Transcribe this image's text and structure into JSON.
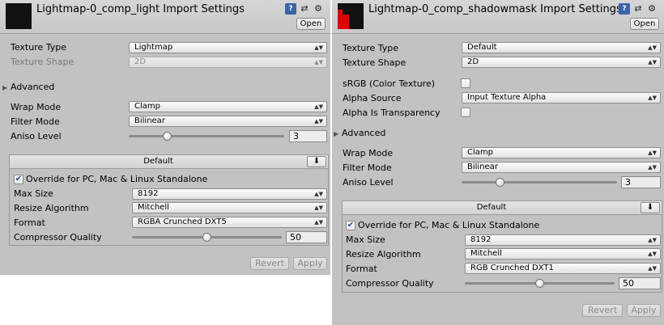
{
  "left": {
    "title": "Lightmap-0_comp_light Import Settings",
    "open_label": "Open",
    "texture_type": {
      "label": "Texture Type",
      "value": "Lightmap"
    },
    "texture_shape": {
      "label": "Texture Shape",
      "value": "2D"
    },
    "advanced_label": "Advanced",
    "wrap_mode": {
      "label": "Wrap Mode",
      "value": "Clamp"
    },
    "filter_mode": {
      "label": "Filter Mode",
      "value": "Bilinear"
    },
    "aniso_level": {
      "label": "Aniso Level",
      "value": "3",
      "fraction": 0.25
    },
    "platform": {
      "tab_label": "Default",
      "override_label": "Override for PC, Mac & Linux Standalone",
      "override_checked": true,
      "max_size": {
        "label": "Max Size",
        "value": "8192"
      },
      "resize_algorithm": {
        "label": "Resize Algorithm",
        "value": "Mitchell"
      },
      "format": {
        "label": "Format",
        "value": "RGBA Crunched DXT5"
      },
      "compressor_quality": {
        "label": "Compressor Quality",
        "value": "50",
        "fraction": 0.5
      }
    },
    "revert_label": "Revert",
    "apply_label": "Apply"
  },
  "right": {
    "title": "Lightmap-0_comp_shadowmask Import Settings",
    "open_label": "Open",
    "texture_type": {
      "label": "Texture Type",
      "value": "Default"
    },
    "texture_shape": {
      "label": "Texture Shape",
      "value": "2D"
    },
    "srgb": {
      "label": "sRGB (Color Texture)",
      "checked": false
    },
    "alpha_source": {
      "label": "Alpha Source",
      "value": "Input Texture Alpha"
    },
    "alpha_is_transparency": {
      "label": "Alpha Is Transparency",
      "checked": false
    },
    "advanced_label": "Advanced",
    "wrap_mode": {
      "label": "Wrap Mode",
      "value": "Clamp"
    },
    "filter_mode": {
      "label": "Filter Mode",
      "value": "Bilinear"
    },
    "aniso_level": {
      "label": "Aniso Level",
      "value": "3",
      "fraction": 0.25
    },
    "platform": {
      "tab_label": "Default",
      "override_label": "Override for PC, Mac & Linux Standalone",
      "override_checked": true,
      "max_size": {
        "label": "Max Size",
        "value": "8192"
      },
      "resize_algorithm": {
        "label": "Resize Algorithm",
        "value": "Mitchell"
      },
      "format": {
        "label": "Format",
        "value": "RGB Crunched DXT1"
      },
      "compressor_quality": {
        "label": "Compressor Quality",
        "value": "50",
        "fraction": 0.5
      }
    },
    "revert_label": "Revert",
    "apply_label": "Apply"
  },
  "icons": {
    "help": "help-book-icon",
    "presets": "presets-sliders-icon",
    "settings": "gear-icon",
    "dropdown_arrow": "updown-arrow-icon",
    "download": "download-arrow-icon"
  },
  "colors": {
    "panel_bg": "#c2c2c2",
    "thumb_dark": "#111111",
    "thumb_red": "#e00000",
    "check_mark": "#2a4a8a"
  }
}
